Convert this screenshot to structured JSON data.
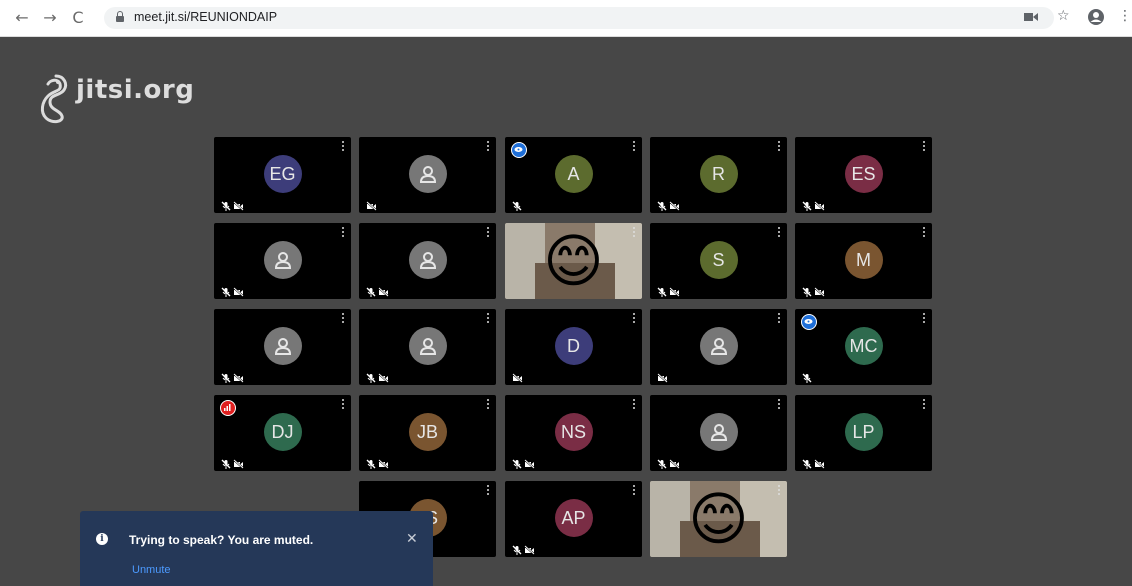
{
  "browser": {
    "url": "meet.jit.si/REUNIONDAIP"
  },
  "logo": {
    "text": "jitsi.org"
  },
  "colors": {
    "background": "#474747",
    "tile": "#000000",
    "toast": "#253858",
    "link": "#4c9aff"
  },
  "tiles": [
    {
      "initials": "EG",
      "avatar_color": "#3d3d7a",
      "mic_muted": true,
      "video_off": true
    },
    {
      "initials": "",
      "avatar_color": "#777777",
      "mic_muted": false,
      "video_off": true
    },
    {
      "initials": "A",
      "avatar_color": "#5c6b2e",
      "mic_muted": true,
      "video_off": false,
      "badge": "connection-good"
    },
    {
      "initials": "R",
      "avatar_color": "#5c6b2e",
      "mic_muted": true,
      "video_off": true
    },
    {
      "initials": "ES",
      "avatar_color": "#7a2d45",
      "mic_muted": true,
      "video_off": true
    },
    {
      "initials": "",
      "avatar_color": "#777777",
      "mic_muted": true,
      "video_off": true
    },
    {
      "initials": "",
      "avatar_color": "#777777",
      "mic_muted": true,
      "video_off": true
    },
    {
      "initials": "",
      "video": true,
      "emoji": "😊"
    },
    {
      "initials": "S",
      "avatar_color": "#5c6b2e",
      "mic_muted": true,
      "video_off": true
    },
    {
      "initials": "M",
      "avatar_color": "#7a5530",
      "mic_muted": true,
      "video_off": true
    },
    {
      "initials": "",
      "avatar_color": "#777777",
      "mic_muted": true,
      "video_off": true
    },
    {
      "initials": "",
      "avatar_color": "#777777",
      "mic_muted": true,
      "video_off": true
    },
    {
      "initials": "D",
      "avatar_color": "#3d3d7a",
      "mic_muted": false,
      "video_off": true
    },
    {
      "initials": "",
      "avatar_color": "#777777",
      "mic_muted": false,
      "video_off": true
    },
    {
      "initials": "MC",
      "avatar_color": "#2e6a4e",
      "mic_muted": true,
      "video_off": false,
      "badge": "connection-good"
    },
    {
      "initials": "DJ",
      "avatar_color": "#2e6a4e",
      "mic_muted": true,
      "video_off": true,
      "badge": "connection-poor"
    },
    {
      "initials": "JB",
      "avatar_color": "#7a5530",
      "mic_muted": true,
      "video_off": true
    },
    {
      "initials": "NS",
      "avatar_color": "#7a2d45",
      "mic_muted": true,
      "video_off": true
    },
    {
      "initials": "",
      "avatar_color": "#777777",
      "mic_muted": true,
      "video_off": true
    },
    {
      "initials": "LP",
      "avatar_color": "#2e6a4e",
      "mic_muted": true,
      "video_off": true
    },
    {
      "initials": "JS",
      "avatar_color": "#7a5530",
      "mic_muted": false,
      "video_off": false
    },
    {
      "initials": "AP",
      "avatar_color": "#7a2d45",
      "mic_muted": true,
      "video_off": true
    },
    {
      "initials": "",
      "video": true,
      "emoji": "😊"
    }
  ],
  "toast": {
    "title": "Trying to speak? You are muted.",
    "action": "Unmute",
    "close": "✕"
  }
}
